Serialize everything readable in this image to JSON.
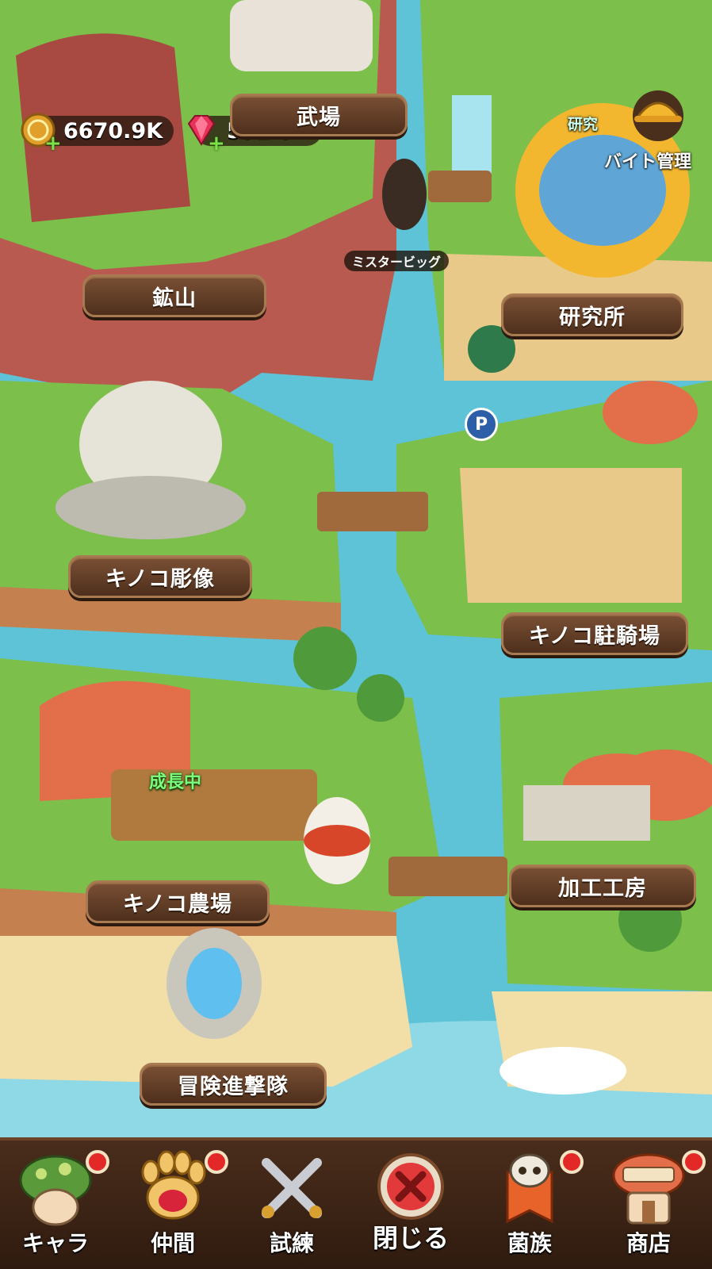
{
  "currencies": {
    "gold": {
      "value": "6670.9K",
      "icon": "gold-coin-icon",
      "add_icon": "+"
    },
    "gem": {
      "value": "592.9K",
      "icon": "red-gem-icon",
      "add_icon": "+"
    }
  },
  "map_locations": {
    "arena_partial": "武場",
    "mine": "鉱山",
    "research_lab": "研究所",
    "mushroom_statue": "キノコ彫像",
    "mushroom_parking": "キノコ駐騎場",
    "mushroom_farm": "キノコ農場",
    "processing_workshop": "加工工房",
    "adventure_squad": "冒険進撃隊"
  },
  "floating_labels": {
    "research_partial": "研究",
    "part_time_management": "バイト管理",
    "npc_name": "ミスタービッグ",
    "farm_status": "成長中",
    "parking_sign": "P"
  },
  "bottom_nav": {
    "items": [
      {
        "label": "キャラ",
        "icon": "mushroom-character-icon",
        "badge": true
      },
      {
        "label": "仲間",
        "icon": "paw-icon",
        "badge": true
      },
      {
        "label": "試練",
        "icon": "crossed-swords-icon",
        "badge": false
      },
      {
        "label": "閉じる",
        "icon": "close-icon",
        "badge": false
      },
      {
        "label": "菌族",
        "icon": "skull-banner-icon",
        "badge": true
      },
      {
        "label": "商店",
        "icon": "shop-icon",
        "badge": true
      }
    ]
  },
  "colors": {
    "water": "#5ec3d6",
    "grass": "#7cbf4a",
    "cliff": "#b85a4f",
    "plate_wood": "#5e3a24",
    "badge_red": "#e32828",
    "status_green": "#7bff7a"
  }
}
